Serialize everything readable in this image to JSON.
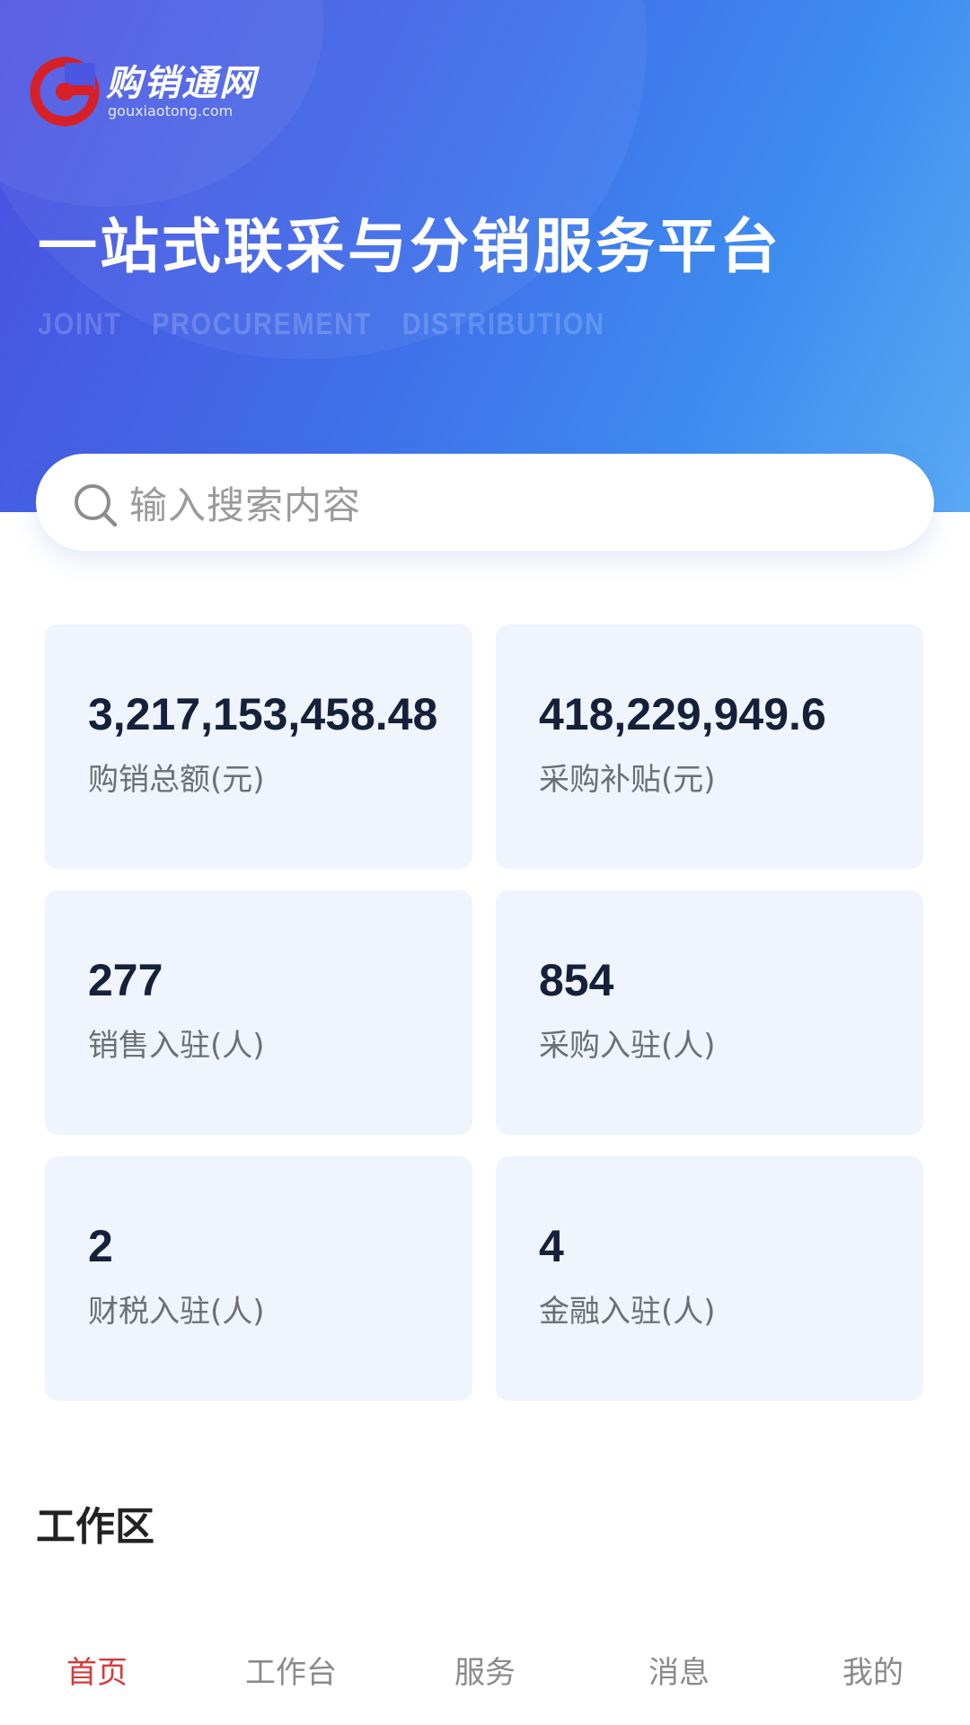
{
  "header": {
    "logo_name": "购销通网",
    "logo_domain": "gouxiaotong.com",
    "title": "一站式联采与分销服务平台",
    "subtitle": "JOINT PROCUREMENT DISTRIBUTION"
  },
  "search": {
    "placeholder": "输入搜索内容",
    "icon": "search-icon"
  },
  "stats": [
    {
      "value": "3,217,153,458.48",
      "label": "购销总额(元)"
    },
    {
      "value": "418,229,949.6",
      "label": "采购补贴(元)"
    },
    {
      "value": "277",
      "label": "销售入驻(人)"
    },
    {
      "value": "854",
      "label": "采购入驻(人)"
    },
    {
      "value": "2",
      "label": "财税入驻(人)"
    },
    {
      "value": "4",
      "label": "金融入驻(人)"
    }
  ],
  "workspace": {
    "title": "工作区"
  },
  "tabbar": {
    "items": [
      {
        "label": "首页",
        "active": true
      },
      {
        "label": "工作台",
        "active": false
      },
      {
        "label": "服务",
        "active": false
      },
      {
        "label": "消息",
        "active": false
      },
      {
        "label": "我的",
        "active": false
      }
    ]
  },
  "colors": {
    "brand_red": "#d61f26",
    "active_tab": "#d63a3a",
    "hero_start": "#4b4fe0",
    "hero_end": "#5aa9f4",
    "card_bg": "#eff4fd",
    "value_text": "#16203a"
  }
}
